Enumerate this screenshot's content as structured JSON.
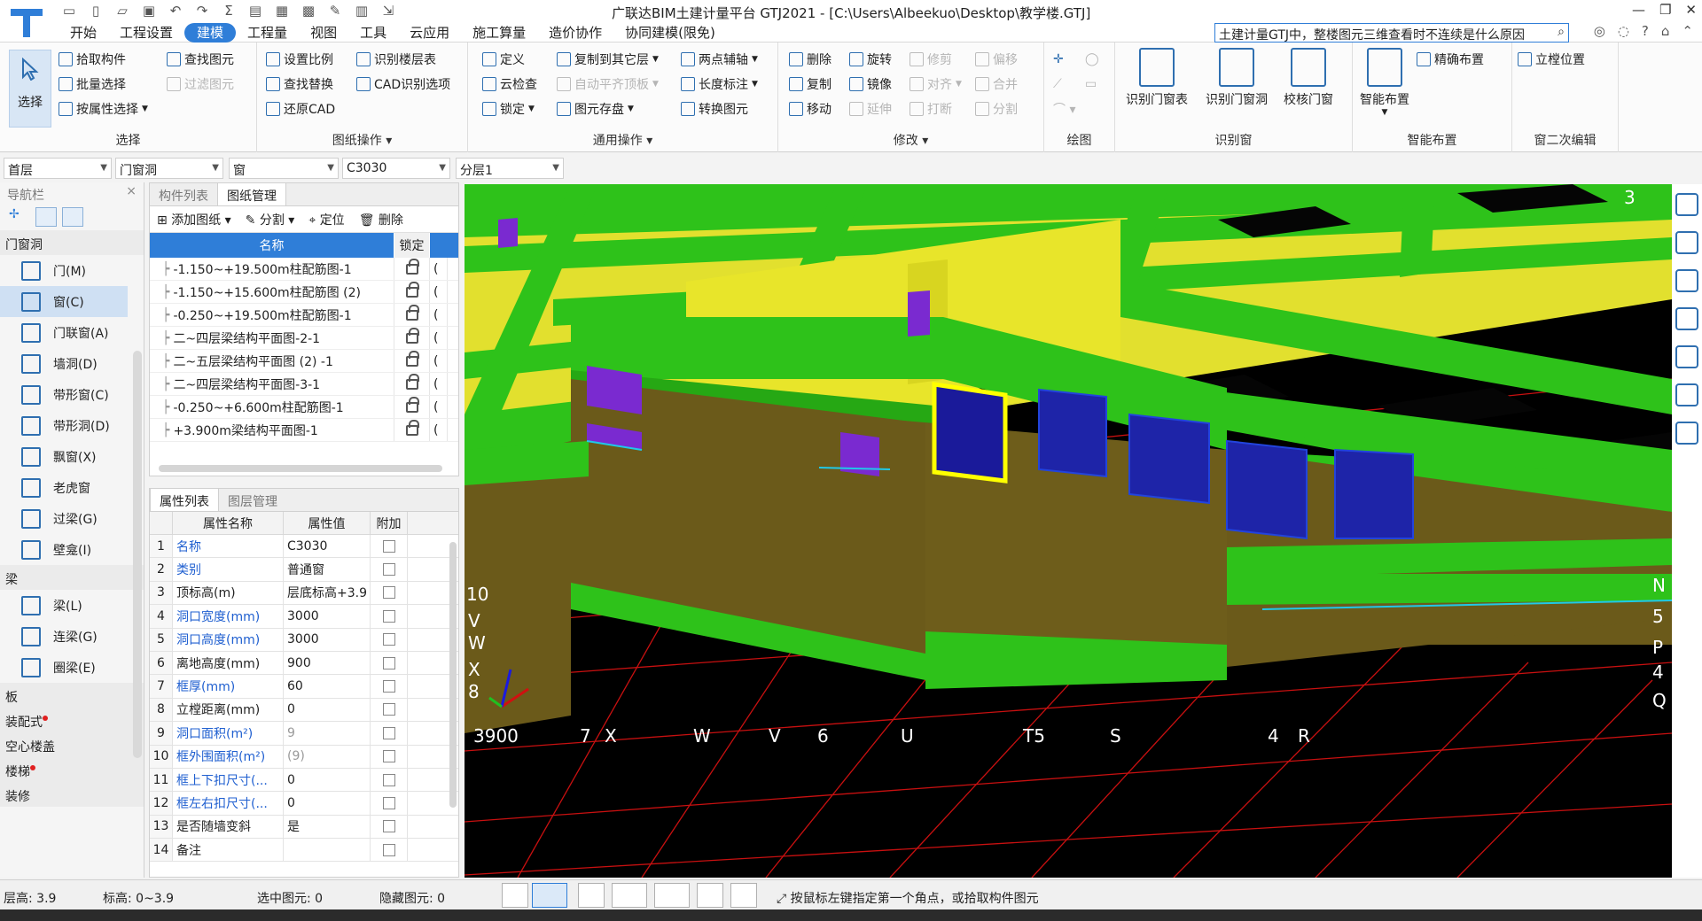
{
  "window": {
    "title": "广联达BIM土建计量平台 GTJ2021 - [C:\\Users\\Albeekuo\\Desktop\\教学楼.GTJ]"
  },
  "menu_tabs": [
    "开始",
    "工程设置",
    "建模",
    "工程量",
    "视图",
    "工具",
    "云应用",
    "施工算量",
    "造价协作",
    "协同建模(限免)"
  ],
  "search": {
    "value": "土建计量GTJ中，整楼图元三维查看时不连续是什么原因"
  },
  "ribbon": {
    "select": {
      "label": "选择",
      "group": "选择",
      "items": [
        "拾取构件",
        "批量选择",
        "按属性选择"
      ],
      "items2": [
        "查找图元",
        "过滤图元"
      ]
    },
    "drawing_ops": {
      "group": "图纸操作",
      "items": [
        "设置比例",
        "查找替换",
        "还原CAD"
      ],
      "items2": [
        "识别楼层表",
        "CAD识别选项"
      ]
    },
    "common_ops": {
      "group": "通用操作",
      "items": [
        "定义",
        "云检查",
        "锁定"
      ],
      "items2": [
        "复制到其它层",
        "自动平齐顶板",
        "图元存盘"
      ],
      "items3": [
        "两点辅轴",
        "长度标注",
        "转换图元"
      ]
    },
    "modify": {
      "group": "修改",
      "items": [
        "删除",
        "复制",
        "移动"
      ],
      "items2": [
        "旋转",
        "镜像",
        "延伸"
      ],
      "items3": [
        "修剪",
        "对齐",
        "打断"
      ],
      "items4": [
        "偏移",
        "合并",
        "分割"
      ]
    },
    "draw": {
      "group": "绘图"
    },
    "recognize_window": {
      "group": "识别窗",
      "items": [
        "识别门窗表",
        "识别门窗洞",
        "校核门窗"
      ]
    },
    "smart_layout": {
      "group": "智能布置",
      "big": "智能布置",
      "item": "精确布置"
    },
    "window_edit": {
      "group": "窗二次编辑",
      "item": "立樘位置"
    }
  },
  "dropdowns": {
    "floor": "首层",
    "category": "门窗洞",
    "type": "窗",
    "component": "C3030",
    "layer": "分层1"
  },
  "nav": {
    "title": "导航栏",
    "categories": [
      {
        "name": "门窗洞",
        "items": [
          "门(M)",
          "窗(C)",
          "门联窗(A)",
          "墙洞(D)",
          "带形窗(C)",
          "带形洞(D)",
          "飘窗(X)",
          "老虎窗",
          "过梁(G)",
          "壁龛(I)"
        ]
      },
      {
        "name": "梁",
        "items": [
          "梁(L)",
          "连梁(G)",
          "圈梁(E)"
        ]
      }
    ],
    "tail": [
      "板",
      "装配式",
      "空心楼盖",
      "楼梯",
      "装修"
    ],
    "selected": "窗(C)"
  },
  "drawing_panel": {
    "tabs": [
      "构件列表",
      "图纸管理"
    ],
    "tools": [
      "添加图纸",
      "分割",
      "定位",
      "删除"
    ],
    "headers": [
      "名称",
      "锁定"
    ],
    "rows": [
      "-1.150~+19.500m柱配筋图-1",
      "-1.150~+15.600m柱配筋图 (2)",
      "-0.250~+19.500m柱配筋图-1",
      "二~四层梁结构平面图-2-1",
      "二~五层梁结构平面图 (2) -1",
      "二~四层梁结构平面图-3-1",
      "-0.250~+6.600m柱配筋图-1",
      "+3.900m梁结构平面图-1"
    ],
    "extra_col": "("
  },
  "property_panel": {
    "tabs": [
      "属性列表",
      "图层管理"
    ],
    "headers": [
      "属性名称",
      "属性值",
      "附加"
    ],
    "rows": [
      {
        "n": "1",
        "name": "名称",
        "value": "C3030",
        "blue": true
      },
      {
        "n": "2",
        "name": "类别",
        "value": "普通窗",
        "blue": true
      },
      {
        "n": "3",
        "name": "顶标高(m)",
        "value": "层底标高+3.9",
        "blue": false
      },
      {
        "n": "4",
        "name": "洞口宽度(mm)",
        "value": "3000",
        "blue": true
      },
      {
        "n": "5",
        "name": "洞口高度(mm)",
        "value": "3000",
        "blue": true
      },
      {
        "n": "6",
        "name": "离地高度(mm)",
        "value": "900",
        "blue": false
      },
      {
        "n": "7",
        "name": "框厚(mm)",
        "value": "60",
        "blue": true
      },
      {
        "n": "8",
        "name": "立樘距离(mm)",
        "value": "0",
        "blue": false
      },
      {
        "n": "9",
        "name": "洞口面积(m²)",
        "value": "9",
        "blue": true
      },
      {
        "n": "10",
        "name": "框外围面积(m²)",
        "value": "(9)",
        "blue": true
      },
      {
        "n": "11",
        "name": "框上下扣尺寸(...",
        "value": "0",
        "blue": true
      },
      {
        "n": "12",
        "name": "框左右扣尺寸(...",
        "value": "0",
        "blue": true
      },
      {
        "n": "13",
        "name": "是否随墙变斜",
        "value": "是",
        "blue": false
      },
      {
        "n": "14",
        "name": "备注",
        "value": "",
        "blue": false
      }
    ]
  },
  "viewport": {
    "axis_labels_bottom": [
      "3900",
      "7",
      "X",
      "W",
      "V",
      "6",
      "U",
      "T5",
      "S",
      "4",
      "R"
    ],
    "axis_labels_right": [
      "N",
      "5",
      "P",
      "4",
      "Q"
    ],
    "axis_labels_left": [
      "10",
      "V",
      "W",
      "X",
      "8"
    ],
    "corner_label": "3"
  },
  "status": {
    "floor_height_label": "层高:",
    "floor_height": "3.9",
    "elevation_label": "标高:",
    "elevation": "0~3.9",
    "selected_label": "选中图元:",
    "selected": "0",
    "hidden_label": "隐藏图元:",
    "hidden": "0",
    "hint": "按鼠标左键指定第一个角点，或拾取构件图元"
  },
  "colors": {
    "accent": "#2f7ed8",
    "beam_green": "#2ec21a",
    "wall_olive": "#6b5a1a",
    "slab_yellow": "#e4e22c",
    "window_blue": "#1a1aa0",
    "grid_red": "#d01010",
    "highlight_yellow": "#ffff00"
  }
}
